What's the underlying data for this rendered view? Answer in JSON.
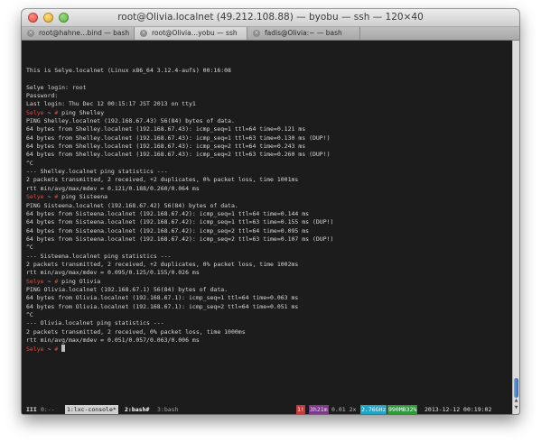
{
  "window": {
    "title": "root@Olivia.localnet (49.212.108.88) — byobu — ssh — 120×40"
  },
  "tabs": [
    {
      "label": "root@hahne…bind — bash",
      "active": false
    },
    {
      "label": "root@Olivia…yobu — ssh",
      "active": true
    },
    {
      "label": "fadis@Olivia:~ — bash",
      "active": false
    }
  ],
  "terminal": {
    "prompt": {
      "user": "Selye",
      "tilde": " ~ ",
      "hash": "#"
    },
    "lines": [
      {
        "kind": "text",
        "text": "This is Selye.localnet (Linux x86_64 3.12.4-aufs) 00:16:08"
      },
      {
        "kind": "text",
        "text": ""
      },
      {
        "kind": "text",
        "text": "Selye login: root"
      },
      {
        "kind": "text",
        "text": "Password:"
      },
      {
        "kind": "text",
        "text": "Last login: Thu Dec 12 00:15:17 JST 2013 on tty1"
      },
      {
        "kind": "prompt",
        "text": " ping Shelley"
      },
      {
        "kind": "text",
        "text": "PING Shelley.localnet (192.168.67.43) 56(84) bytes of data."
      },
      {
        "kind": "text",
        "text": "64 bytes from Shelley.localnet (192.168.67.43): icmp_seq=1 ttl=64 time=0.121 ms"
      },
      {
        "kind": "text",
        "text": "64 bytes from Shelley.localnet (192.168.67.43): icmp_seq=1 ttl=63 time=0.130 ms (DUP!)"
      },
      {
        "kind": "text",
        "text": "64 bytes from Shelley.localnet (192.168.67.43): icmp_seq=2 ttl=64 time=0.243 ms"
      },
      {
        "kind": "text",
        "text": "64 bytes from Shelley.localnet (192.168.67.43): icmp_seq=2 ttl=63 time=0.260 ms (DUP!)"
      },
      {
        "kind": "text",
        "text": "^C"
      },
      {
        "kind": "text",
        "text": "--- Shelley.localnet ping statistics ---"
      },
      {
        "kind": "text",
        "text": "2 packets transmitted, 2 received, +2 duplicates, 0% packet loss, time 1001ms"
      },
      {
        "kind": "text",
        "text": "rtt min/avg/max/mdev = 0.121/0.188/0.260/0.064 ms"
      },
      {
        "kind": "prompt",
        "text": " ping Sisteena"
      },
      {
        "kind": "text",
        "text": "PING Sisteena.localnet (192.168.67.42) 56(84) bytes of data."
      },
      {
        "kind": "text",
        "text": "64 bytes from Sisteena.localnet (192.168.67.42): icmp_seq=1 ttl=64 time=0.144 ms"
      },
      {
        "kind": "text",
        "text": "64 bytes from Sisteena.localnet (192.168.67.42): icmp_seq=1 ttl=63 time=0.155 ms (DUP!)"
      },
      {
        "kind": "text",
        "text": "64 bytes from Sisteena.localnet (192.168.67.42): icmp_seq=2 ttl=64 time=0.095 ms"
      },
      {
        "kind": "text",
        "text": "64 bytes from Sisteena.localnet (192.168.67.42): icmp_seq=2 ttl=63 time=0.107 ms (DUP!)"
      },
      {
        "kind": "text",
        "text": "^C"
      },
      {
        "kind": "text",
        "text": "--- Sisteena.localnet ping statistics ---"
      },
      {
        "kind": "text",
        "text": "2 packets transmitted, 2 received, +2 duplicates, 0% packet loss, time 1002ms"
      },
      {
        "kind": "text",
        "text": "rtt min/avg/max/mdev = 0.095/0.125/0.155/0.026 ms"
      },
      {
        "kind": "prompt",
        "text": " ping Olivia"
      },
      {
        "kind": "text",
        "text": "PING Olivia.localnet (192.168.67.1) 56(84) bytes of data."
      },
      {
        "kind": "text",
        "text": "64 bytes from Olivia.localnet (192.168.67.1): icmp_seq=1 ttl=64 time=0.063 ms"
      },
      {
        "kind": "text",
        "text": "64 bytes from Olivia.localnet (192.168.67.1): icmp_seq=2 ttl=64 time=0.051 ms"
      },
      {
        "kind": "text",
        "text": "^C"
      },
      {
        "kind": "text",
        "text": "--- Olivia.localnet ping statistics ---"
      },
      {
        "kind": "text",
        "text": "2 packets transmitted, 2 received, 0% packet loss, time 1000ms"
      },
      {
        "kind": "text",
        "text": "rtt min/avg/max/mdev = 0.051/0.057/0.063/0.006 ms"
      },
      {
        "kind": "prompt",
        "text": " "
      }
    ]
  },
  "statusbar": {
    "logo": "III",
    "window0": "0:--",
    "window1": "1:lxc-console*",
    "window2": "2:bash#",
    "window3": "3:bash",
    "packages": "1!",
    "uptime": "3h21m",
    "load": "0.01 2x",
    "cpu": "2.76GHz",
    "memory": "990MB32%",
    "datetime": "2013-12-12 00:19:02"
  },
  "colors": {
    "terminal_bg": "#1c1c1c",
    "prompt_user": "#e8463c",
    "cpu_badge": "#1fa6c7",
    "mem_badge": "#2d9a3a",
    "pkg_badge": "#c43a3a",
    "uptime_badge": "#7b3a8a"
  }
}
